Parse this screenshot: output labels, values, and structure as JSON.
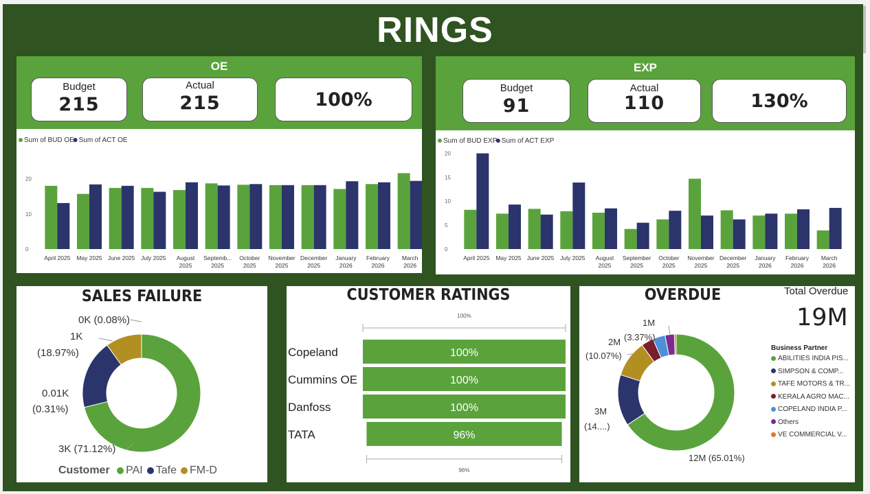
{
  "title": "RINGS",
  "oe": {
    "section_title": "OE",
    "budget_label": "Budget",
    "budget_value": "215",
    "actual_label": "Actual",
    "actual_value": "215",
    "percent": "100%"
  },
  "exp": {
    "section_title": "EXP",
    "budget_label": "Budget",
    "budget_value": "91",
    "actual_label": "Actual",
    "actual_value": "110",
    "percent": "130%"
  },
  "sales_failure": {
    "title": "SALES FAILURE",
    "legend_title": "Customer",
    "slice_labels": [
      "3K (71.12%)",
      "0.01K",
      "(0.31%)",
      "1K",
      "(18.97%)",
      "0K (0.08%)"
    ]
  },
  "customer_ratings": {
    "title": "CUSTOMER RATINGS",
    "top_axis_label": "100%",
    "bottom_axis_label": "96%"
  },
  "overdue": {
    "title": "OVERDUE",
    "total_label": "Total Overdue",
    "total_value": "19M",
    "legend_title": "Business Partner",
    "slice_labels": [
      "12M (65.01%)",
      "3M",
      "(14....)",
      "2M",
      "(10.07%)",
      "1M",
      "(3.37%)"
    ]
  },
  "colors": {
    "green": "#5aa33c",
    "navy": "#2b346b",
    "gold": "#b38f22",
    "maroon": "#7b1e2e",
    "lightblue": "#4e90d8",
    "purple": "#7b2a8e",
    "orange": "#e8732a",
    "background": "#2f5321"
  },
  "chart_data": [
    {
      "type": "bar",
      "name": "oe",
      "categories": [
        "April 2025",
        "May 2025",
        "June 2025",
        "July 2025",
        "August 2025",
        "September 2025",
        "October 2025",
        "November 2025",
        "December 2025",
        "January 2026",
        "February 2026",
        "March 2026"
      ],
      "tick_labels": [
        [
          "April 2025"
        ],
        [
          "May 2025"
        ],
        [
          "June 2025"
        ],
        [
          "July 2025"
        ],
        [
          "August",
          "2025"
        ],
        [
          "Septemb...",
          "2025"
        ],
        [
          "October",
          "2025"
        ],
        [
          "November",
          "2025"
        ],
        [
          "December",
          "2025"
        ],
        [
          "January",
          "2026"
        ],
        [
          "February",
          "2026"
        ],
        [
          "March",
          "2026"
        ]
      ],
      "series": [
        {
          "name": "Sum of BUD OE",
          "values": [
            18,
            15.7,
            17.4,
            17.4,
            16.8,
            18.7,
            18.3,
            18.2,
            18.2,
            17.1,
            18.5,
            21.6
          ]
        },
        {
          "name": "Sum of ACT OE",
          "values": [
            13.1,
            18.4,
            18,
            16.3,
            19,
            18.1,
            18.5,
            18.2,
            18.2,
            19.3,
            19,
            19.4
          ]
        }
      ],
      "yticks": [
        0,
        10,
        20
      ],
      "ylim": [
        0,
        25
      ],
      "grid": false,
      "legend_position": "top-left"
    },
    {
      "type": "bar",
      "name": "exp",
      "categories": [
        "April 2025",
        "May 2025",
        "June 2025",
        "July 2025",
        "August 2025",
        "September 2025",
        "October 2025",
        "November 2025",
        "December 2025",
        "January 2026",
        "February 2026",
        "March 2026"
      ],
      "tick_labels": [
        [
          "April 2025"
        ],
        [
          "May 2025"
        ],
        [
          "June 2025"
        ],
        [
          "July 2025"
        ],
        [
          "August",
          "2025"
        ],
        [
          "September",
          "2025"
        ],
        [
          "October",
          "2025"
        ],
        [
          "November",
          "2025"
        ],
        [
          "December",
          "2025"
        ],
        [
          "January",
          "2026"
        ],
        [
          "February",
          "2026"
        ],
        [
          "March",
          "2026"
        ]
      ],
      "series": [
        {
          "name": "Sum of BUD EXP",
          "values": [
            8.2,
            7.4,
            8.4,
            7.9,
            7.6,
            4.2,
            6.2,
            14.7,
            8.1,
            7,
            7.4,
            3.9
          ]
        },
        {
          "name": "Sum of ACT EXP",
          "values": [
            20,
            9.3,
            7.2,
            13.9,
            8.5,
            5.5,
            8,
            7,
            6.2,
            7.4,
            8.3,
            8.6
          ]
        }
      ],
      "yticks": [
        0,
        5,
        10,
        15,
        20
      ],
      "ylim": [
        0,
        20.5
      ],
      "grid": false,
      "legend_position": "top-left"
    },
    {
      "type": "pie",
      "name": "sales_failure",
      "donut": true,
      "slices": [
        {
          "label": "PAI",
          "value": 71.12
        },
        {
          "label": "Tafe",
          "value": 18.97
        },
        {
          "label": "FM-D",
          "value": 9.91
        }
      ],
      "legend_position": "bottom"
    },
    {
      "type": "bar",
      "name": "customer_ratings",
      "orientation": "horizontal",
      "categories": [
        "Copeland",
        "Cummins OE",
        "Danfoss",
        "TATA"
      ],
      "values": [
        100,
        100,
        100,
        96
      ],
      "value_labels": [
        "100%",
        "100%",
        "100%",
        "96%"
      ]
    },
    {
      "type": "pie",
      "name": "overdue",
      "donut": true,
      "slices": [
        {
          "label": "ABILITIES INDIA PIS...",
          "value": 65.01
        },
        {
          "label": "SIMPSON & COMP...",
          "value": 14.1
        },
        {
          "label": "TAFE MOTORS & TR...",
          "value": 10.07
        },
        {
          "label": "KERALA AGRO MAC...",
          "value": 3.37
        },
        {
          "label": "COPELAND INDIA P...",
          "value": 3.4
        },
        {
          "label": "Others",
          "value": 2.55
        },
        {
          "label": "VE COMMERCIAL V...",
          "value": 0.5
        }
      ],
      "legend_position": "right"
    }
  ]
}
